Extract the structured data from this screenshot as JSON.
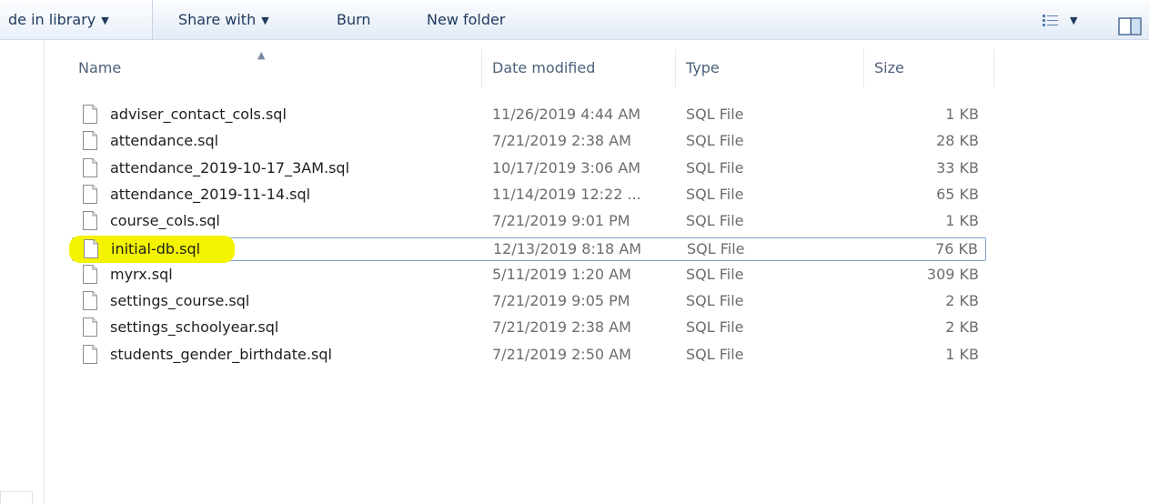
{
  "toolbar": {
    "include_in_library": "de in library",
    "share_with": "Share with",
    "burn": "Burn",
    "new_folder": "New folder"
  },
  "columns": {
    "name": "Name",
    "date_modified": "Date modified",
    "type": "Type",
    "size": "Size"
  },
  "files": [
    {
      "name": "adviser_contact_cols.sql",
      "date": "11/26/2019 4:44 AM",
      "type": "SQL File",
      "size": "1 KB"
    },
    {
      "name": "attendance.sql",
      "date": "7/21/2019 2:38 AM",
      "type": "SQL File",
      "size": "28 KB"
    },
    {
      "name": "attendance_2019-10-17_3AM.sql",
      "date": "10/17/2019 3:06 AM",
      "type": "SQL File",
      "size": "33 KB"
    },
    {
      "name": "attendance_2019-11-14.sql",
      "date": "11/14/2019 12:22 ...",
      "type": "SQL File",
      "size": "65 KB"
    },
    {
      "name": "course_cols.sql",
      "date": "7/21/2019 9:01 PM",
      "type": "SQL File",
      "size": "1 KB"
    },
    {
      "name": "initial-db.sql",
      "date": "12/13/2019 8:18 AM",
      "type": "SQL File",
      "size": "76 KB",
      "selected": true,
      "highlight_color": "#f4f300"
    },
    {
      "name": "myrx.sql",
      "date": "5/11/2019 1:20 AM",
      "type": "SQL File",
      "size": "309 KB"
    },
    {
      "name": "settings_course.sql",
      "date": "7/21/2019 9:05 PM",
      "type": "SQL File",
      "size": "2 KB"
    },
    {
      "name": "settings_schoolyear.sql",
      "date": "7/21/2019 2:38 AM",
      "type": "SQL File",
      "size": "2 KB"
    },
    {
      "name": "students_gender_birthdate.sql",
      "date": "7/21/2019 2:50 AM",
      "type": "SQL File",
      "size": "1 KB"
    }
  ],
  "icons": {
    "file": "file-icon",
    "views": "views-icon",
    "preview_pane": "preview-pane-icon",
    "sort": "sort-ascending-icon"
  },
  "colors": {
    "selection_border": "#7da2ce",
    "highlighter": "#f4f300",
    "toolbar_text": "#1e395b"
  }
}
